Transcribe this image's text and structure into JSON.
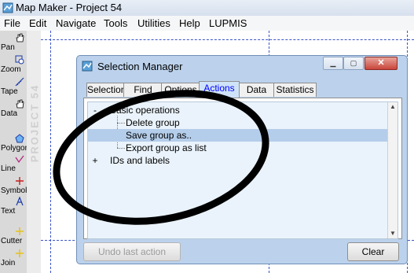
{
  "window": {
    "title": "Map Maker - Project 54"
  },
  "menu": [
    "File",
    "Edit",
    "Navigate",
    "Tools",
    "Utilities",
    "Help",
    "LUPMIS"
  ],
  "toolbar": [
    {
      "label": "Pan",
      "icon": "hand-icon"
    },
    {
      "label": "Zoom",
      "icon": "zoom-icon"
    },
    {
      "label": "Tape",
      "icon": "tape-icon"
    },
    {
      "label": "Data",
      "icon": "data-icon"
    },
    {
      "label": "Polygon",
      "icon": "polygon-icon"
    },
    {
      "label": "Line",
      "icon": "line-icon"
    },
    {
      "label": "Symbol",
      "icon": "symbol-icon"
    },
    {
      "label": "Text",
      "icon": "text-icon"
    },
    {
      "label": "Cutter",
      "icon": "cutter-icon"
    },
    {
      "label": "Join",
      "icon": "join-icon"
    }
  ],
  "watermark": "PROJECT 54",
  "dialog": {
    "title": "Selection Manager",
    "tabs": [
      "Selection",
      "Find",
      "Options",
      "Actions",
      "Data",
      "Statistics"
    ],
    "active_tab": "Actions",
    "tree": [
      {
        "label": "Basic operations",
        "expander": "-",
        "level": 0
      },
      {
        "label": "Delete group",
        "level": 1
      },
      {
        "label": "Save group as..",
        "level": 1,
        "selected": true
      },
      {
        "label": "Export group as list",
        "level": 1
      },
      {
        "label": "IDs and labels",
        "expander": "+",
        "level": 0
      }
    ],
    "buttons": {
      "undo": "Undo last action",
      "clear": "Clear"
    }
  },
  "colors": {
    "grid": "#3b55c8",
    "selection": "#b4cdea",
    "active_tab_text": "#0000ff",
    "annotation": "#000000"
  }
}
